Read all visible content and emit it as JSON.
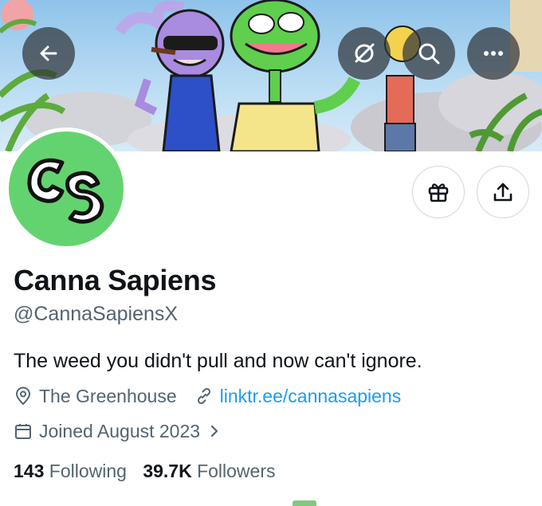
{
  "profile": {
    "display_name": "Canna Sapiens",
    "handle": "@CannaSapiensX",
    "bio": "The weed you didn't pull and now can't ignore.",
    "location": "The Greenhouse",
    "website": "linktr.ee/cannasapiens",
    "joined": "Joined August 2023",
    "following_count": "143",
    "following_label": "Following",
    "followers_count": "39.7K",
    "followers_label": "Followers",
    "avatar_logo_text": "CS"
  },
  "header_buttons": {
    "back_icon": "arrow-left-icon",
    "grok_icon": "slashed-circle-icon",
    "search_icon": "search-icon",
    "more_icon": "more-dots-icon"
  },
  "action_buttons": {
    "gift_icon": "gift-icon",
    "share_icon": "share-upload-icon"
  },
  "colors": {
    "link": "#1d9bf0",
    "avatar_bg": "#63d36f",
    "secondary_text": "#536471",
    "primary_text": "#0f1419"
  }
}
